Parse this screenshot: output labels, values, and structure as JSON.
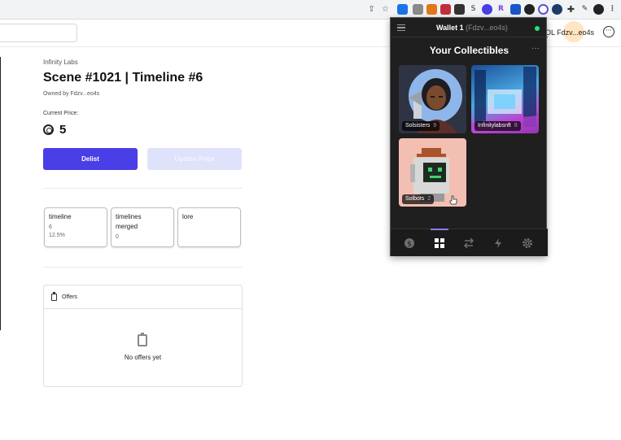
{
  "browser": {
    "extensions": [
      "G",
      "✉",
      "🦊",
      "V",
      "▣",
      "S",
      "◎",
      "R",
      "■",
      "◐",
      "◑",
      "◉",
      "✎",
      "✚",
      "●"
    ]
  },
  "header": {
    "user_address": "OL  Fdzv...eo4s",
    "menu_icon": "more-horizontal-circle-icon"
  },
  "nft": {
    "collection": "Infinity Labs",
    "title": "Scene #1021 | Timeline #6",
    "owner": "Owned by Fdzv...eo4s",
    "price_label": "Current Price:",
    "price": "5",
    "currency_icon": "solana-coin-icon"
  },
  "actions": {
    "delist": "Delist",
    "update_price": "Update Price"
  },
  "attributes": [
    {
      "name": "timeline",
      "value": "6",
      "rarity": "12.5%"
    },
    {
      "name": "timelines merged",
      "value": "0",
      "rarity": ""
    },
    {
      "name": "lore",
      "value": "",
      "rarity": ""
    }
  ],
  "offers": {
    "title": "Offers",
    "empty_text": "No offers yet"
  },
  "wallet": {
    "name": "Wallet 1",
    "address": "(Fdzv...eo4s)",
    "section_title": "Your Collectibles",
    "collectibles": [
      {
        "name": "Solsisters",
        "count": "9"
      },
      {
        "name": "Infinitylabsnft",
        "count": "8"
      },
      {
        "name": "Solbots",
        "count": "2"
      }
    ],
    "nav": [
      "dollar-icon",
      "grid-icon",
      "swap-icon",
      "lightning-icon",
      "gear-icon"
    ],
    "colors": {
      "accent": "#4a3ee6",
      "connected": "#21e56f"
    }
  }
}
